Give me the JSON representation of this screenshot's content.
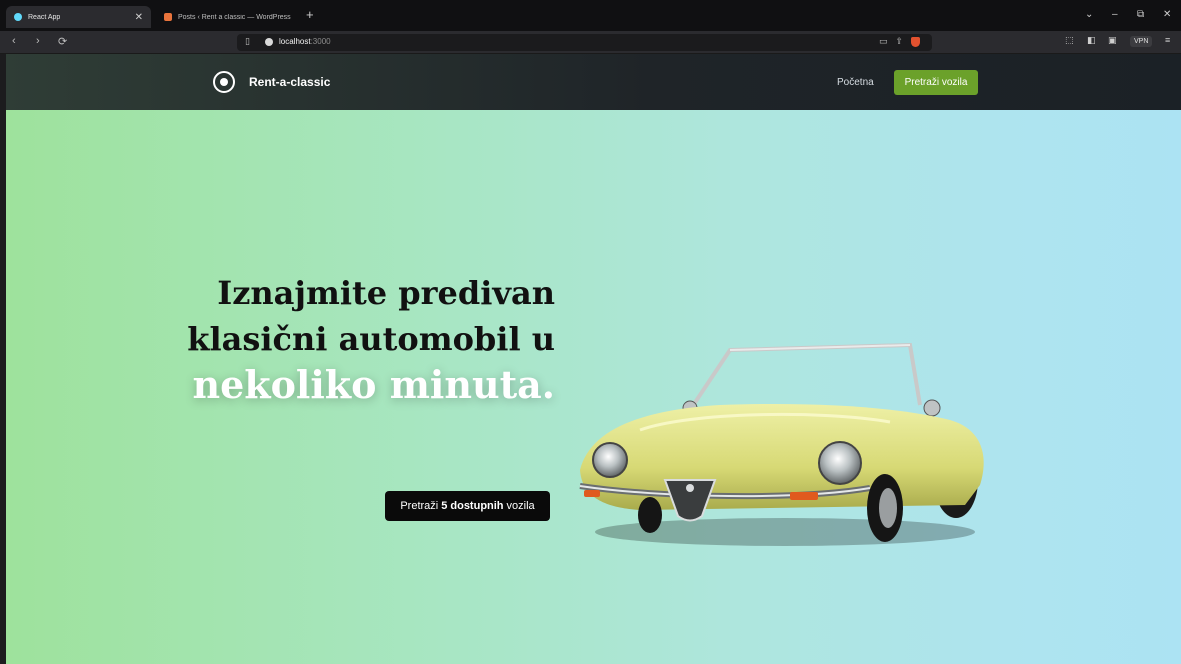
{
  "browser": {
    "tabs": [
      {
        "title": "React App",
        "active": true
      },
      {
        "title": "Posts ‹ Rent a classic — WordPress",
        "active": false
      }
    ],
    "url_host": "localhost",
    "url_port": ":3000",
    "vpn_label": "VPN"
  },
  "header": {
    "brand": "Rent-a-classic",
    "nav_home": "Početna",
    "nav_search": "Pretraži vozila",
    "search_color": "#6ba12a"
  },
  "hero": {
    "headline_line1": "Iznajmite predivan",
    "headline_line2": "klasični automobil u",
    "headline_accent": "nekoliko minuta.",
    "cta_prefix": "Pretraži",
    "cta_count": "5",
    "cta_bold": "dostupnih",
    "cta_suffix": "vozila",
    "car_color": "#dfe08a"
  }
}
